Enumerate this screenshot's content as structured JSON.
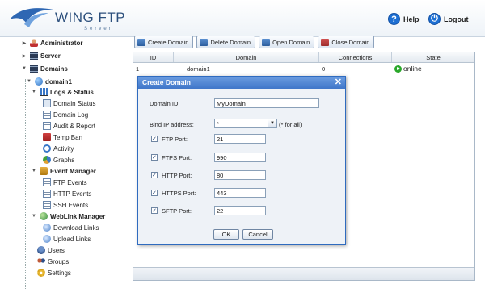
{
  "app": {
    "logo_text": "WING FTP",
    "logo_sub": "Server",
    "help_label": "Help",
    "logout_label": "Logout"
  },
  "tree": {
    "administrator": "Administrator",
    "server": "Server",
    "domains": "Domains",
    "domain1": "domain1",
    "logs_status": "Logs & Status",
    "domain_status": "Domain Status",
    "domain_log": "Domain Log",
    "audit_report": "Audit & Report",
    "temp_ban": "Temp Ban",
    "activity": "Activity",
    "graphs": "Graphs",
    "event_manager": "Event Manager",
    "ftp_events": "FTP Events",
    "http_events": "HTTP Events",
    "ssh_events": "SSH Events",
    "weblink_manager": "WebLink Manager",
    "download_links": "Download Links",
    "upload_links": "Upload Links",
    "users": "Users",
    "groups": "Groups",
    "settings": "Settings"
  },
  "toolbar": {
    "create": "Create Domain",
    "delete": "Delete Domain",
    "open": "Open Domain",
    "close": "Close Domain"
  },
  "grid": {
    "columns": [
      "ID",
      "Domain",
      "Connections",
      "State"
    ],
    "rows": [
      {
        "id": "1",
        "domain": "domain1",
        "connections": "0",
        "state": "online"
      }
    ]
  },
  "dialog": {
    "title": "Create Domain",
    "domain_id_label": "Domain ID:",
    "domain_id_value": "MyDomain",
    "bind_ip_label": "Bind IP address:",
    "bind_ip_value": "*",
    "bind_ip_hint": "(* for all)",
    "ports": [
      {
        "label": "FTP Port:",
        "value": "21"
      },
      {
        "label": "FTPS Port:",
        "value": "990"
      },
      {
        "label": "HTTP Port:",
        "value": "80"
      },
      {
        "label": "HTTPS Port:",
        "value": "443"
      },
      {
        "label": "SFTP Port:",
        "value": "22"
      }
    ],
    "ok_label": "OK",
    "cancel_label": "Cancel"
  },
  "colors": {
    "accent": "#3f76c9",
    "online": "#2aa82a"
  }
}
